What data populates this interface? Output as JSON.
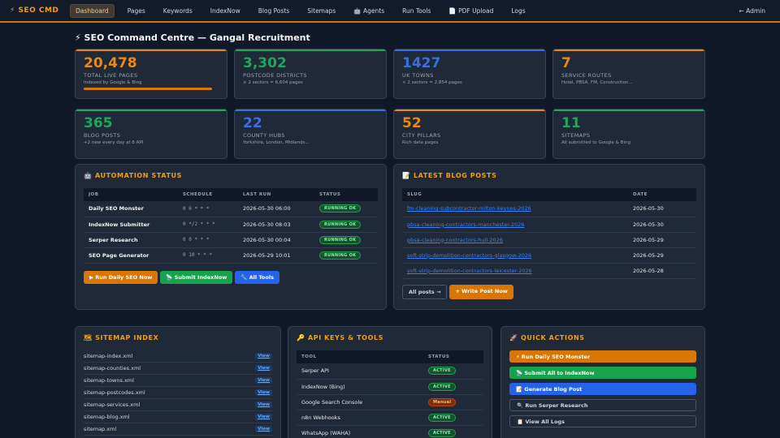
{
  "nav": {
    "brand": "⚡ SEO CMD",
    "items": [
      {
        "label": "Dashboard",
        "active": true
      },
      {
        "label": "Pages"
      },
      {
        "label": "Keywords"
      },
      {
        "label": "IndexNow"
      },
      {
        "label": "Blog Posts"
      },
      {
        "label": "Sitemaps"
      },
      {
        "label": "🤖 Agents"
      },
      {
        "label": "Run Tools"
      },
      {
        "label": "📄 PDF Upload"
      },
      {
        "label": "Logs"
      }
    ],
    "admin": "← Admin"
  },
  "page_title": "⚡ SEO Command Centre — Gangal Recruitment",
  "stats": [
    {
      "value": "20,478",
      "label": "TOTAL LIVE PAGES",
      "sub": "Indexed by Google & Bing",
      "color": "#e8891a",
      "progress": 1.0
    },
    {
      "value": "3,302",
      "label": "POSTCODE DISTRICTS",
      "sub": "× 2 sectors = 6,604 pages",
      "color": "#22a55a"
    },
    {
      "value": "1427",
      "label": "UK TOWNS",
      "sub": "× 2 sectors = 2,854 pages",
      "color": "#3b6fe0"
    },
    {
      "value": "7",
      "label": "SERVICE ROUTES",
      "sub": "Hotel, PBSA, FM, Construction...",
      "color": "#e8891a"
    },
    {
      "value": "365",
      "label": "BLOG POSTS",
      "sub": "+2 new every day at 6 AM",
      "color": "#22a55a"
    },
    {
      "value": "22",
      "label": "COUNTY HUBS",
      "sub": "Yorkshire, London, Midlands...",
      "color": "#3b6fe0"
    },
    {
      "value": "52",
      "label": "CITY PILLARS",
      "sub": "Rich data pages",
      "color": "#e8891a"
    },
    {
      "value": "11",
      "label": "SITEMAPS",
      "sub": "All submitted to Google & Bing",
      "color": "#22a55a"
    }
  ],
  "automation": {
    "title": "🤖 AUTOMATION STATUS",
    "headers": [
      "JOB",
      "SCHEDULE",
      "LAST RUN",
      "STATUS"
    ],
    "rows": [
      {
        "job": "Daily SEO Monster",
        "schedule": "0 6 * * *",
        "last_run": "2026-05-30 06:00",
        "status": "RUNNING OK"
      },
      {
        "job": "IndexNow Submitter",
        "schedule": "0 */2 * * *",
        "last_run": "2026-05-30 08:03",
        "status": "RUNNING OK"
      },
      {
        "job": "Serper Research",
        "schedule": "0 0 * * *",
        "last_run": "2026-05-30 00:04",
        "status": "RUNNING OK"
      },
      {
        "job": "SEO Page Generator",
        "schedule": "0 10 * * *",
        "last_run": "2026-05-29 10:01",
        "status": "RUNNING OK"
      }
    ],
    "buttons": [
      "▶ Run Daily SEO Now",
      "📡 Submit IndexNow",
      "🔧 All Tools"
    ]
  },
  "blog": {
    "title": "📝 LATEST BLOG POSTS",
    "headers": [
      "SLUG",
      "DATE"
    ],
    "rows": [
      {
        "slug": "fm-cleaning-subcontractor-milton-keynes-2026",
        "date": "2026-05-30"
      },
      {
        "slug": "pbsa-cleaning-contractors-manchester-2026",
        "date": "2026-05-30"
      },
      {
        "slug": "pbsa-cleaning-contractors-hull-2026",
        "date": "2026-05-29"
      },
      {
        "slug": "soft-strip-demolition-contractors-glasgow-2026",
        "date": "2026-05-29"
      },
      {
        "slug": "soft-strip-demolition-contractors-leicester-2026",
        "date": "2026-05-28"
      }
    ],
    "buttons": [
      "All posts →",
      "+ Write Post Now"
    ]
  },
  "sitemaps": {
    "title": "🗺 SITEMAP INDEX",
    "view_label": "View",
    "items": [
      "sitemap-index.xml",
      "sitemap-counties.xml",
      "sitemap-towns.xml",
      "sitemap-postcodes.xml",
      "sitemap-services.xml",
      "sitemap-blog.xml",
      "sitemap.xml"
    ]
  },
  "api": {
    "title": "🔑 API KEYS & TOOLS",
    "headers": [
      "TOOL",
      "STATUS"
    ],
    "rows": [
      {
        "tool": "Serper API",
        "status": "ACTIVE"
      },
      {
        "tool": "IndexNow (Bing)",
        "status": "ACTIVE"
      },
      {
        "tool": "Google Search Console",
        "status": "Manual"
      },
      {
        "tool": "n8n Webhooks",
        "status": "ACTIVE"
      },
      {
        "tool": "WhatsApp (WAHA)",
        "status": "ACTIVE"
      }
    ]
  },
  "quick_actions": {
    "title": "🚀 QUICK ACTIONS",
    "items": [
      {
        "label": "⚡ Run Daily SEO Monster",
        "style": "orange"
      },
      {
        "label": "📡 Submit All to IndexNow",
        "style": "green"
      },
      {
        "label": "📝 Generate Blog Post",
        "style": "blue"
      },
      {
        "label": "🔍 Run Serper Research",
        "style": "ghost"
      },
      {
        "label": "📋 View All Logs",
        "style": "ghost"
      }
    ]
  }
}
